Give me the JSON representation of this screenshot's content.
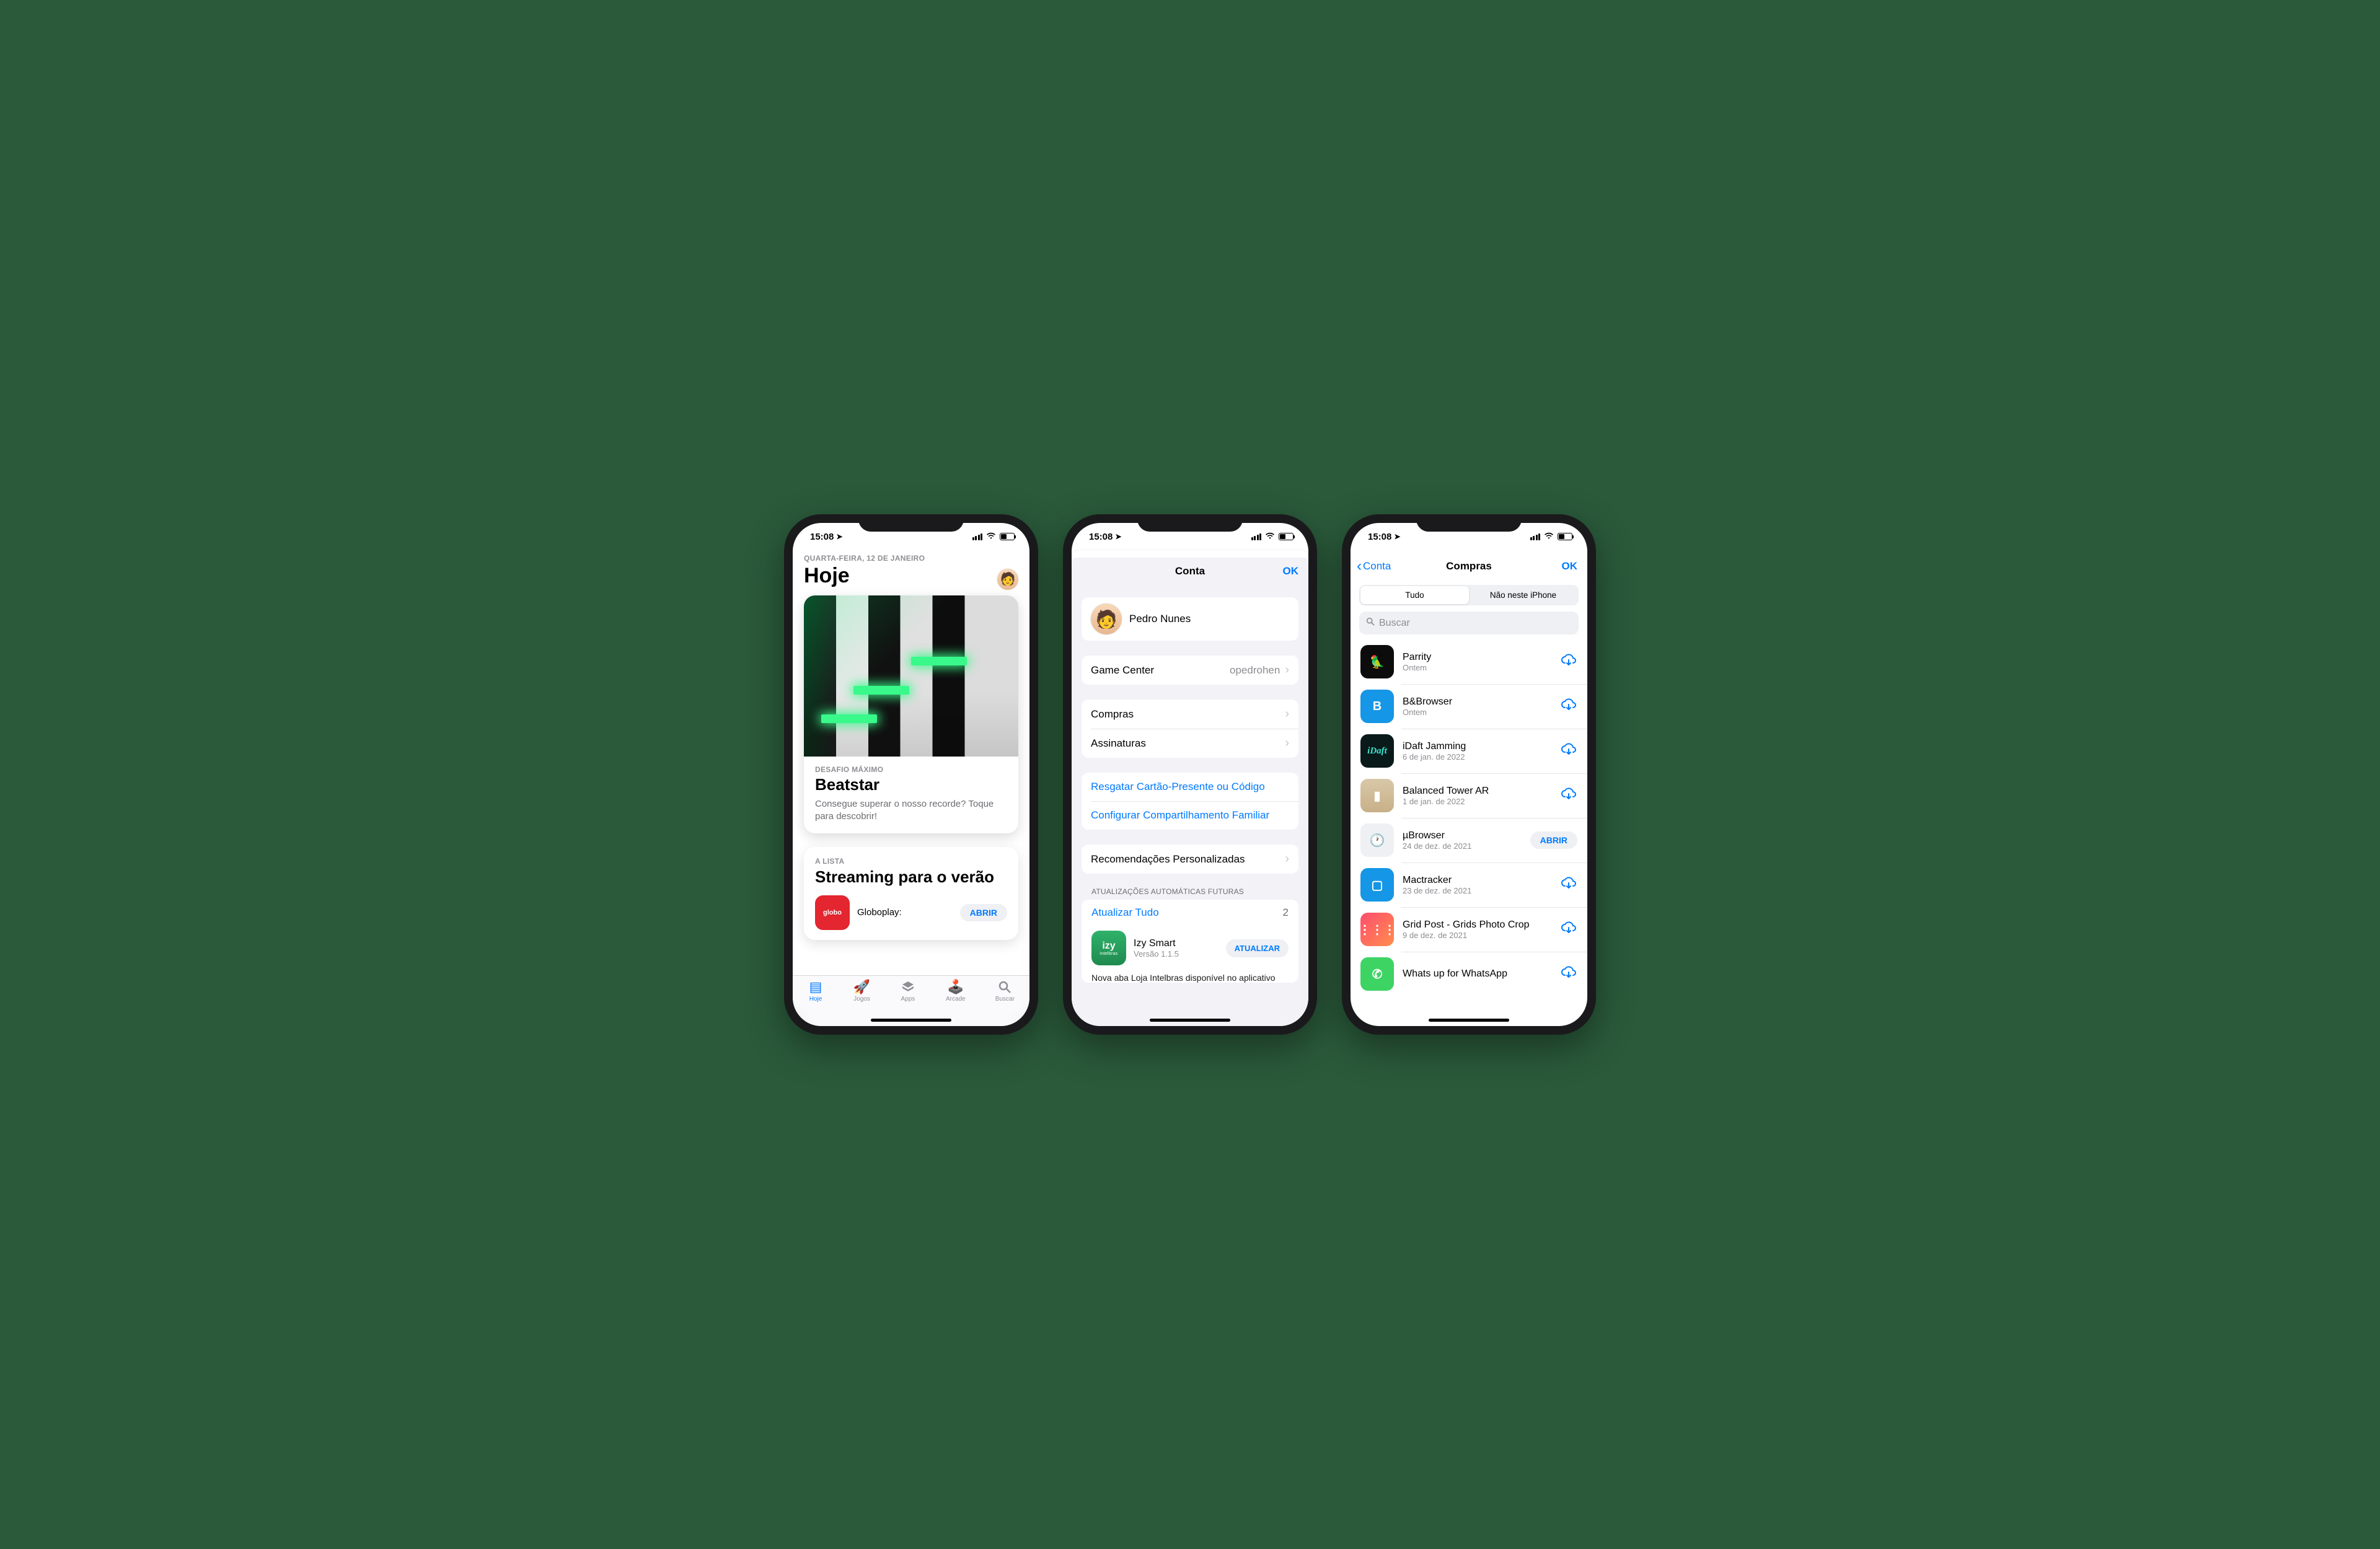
{
  "status": {
    "time": "15:08"
  },
  "phone1": {
    "date": "QUARTA-FEIRA, 12 DE JANEIRO",
    "title": "Hoje",
    "card1": {
      "eyebrow": "DESAFIO MÁXIMO",
      "title": "Beatstar",
      "sub": "Consegue superar o nosso recorde? Toque para descobrir!"
    },
    "card2": {
      "eyebrow": "A LISTA",
      "title": "Streaming para o verão",
      "app_icon_text": "globo",
      "app_name": "Globoplay:",
      "app_btn": "ABRIR"
    },
    "tabs": [
      "Hoje",
      "Jogos",
      "Apps",
      "Arcade",
      "Buscar"
    ]
  },
  "phone2": {
    "nav_title": "Conta",
    "ok": "OK",
    "profile_name": "Pedro Nunes",
    "gamecenter_label": "Game Center",
    "gamecenter_value": "opedrohen",
    "compras": "Compras",
    "assinaturas": "Assinaturas",
    "resgatar": "Resgatar Cartão-Presente ou Código",
    "compart": "Configurar Compartilhamento Familiar",
    "recom": "Recomendações Personalizadas",
    "updates_header": "ATUALIZAÇÕES AUTOMÁTICAS FUTURAS",
    "update_all": "Atualizar Tudo",
    "update_count": "2",
    "upd_app": "Izy Smart",
    "upd_ver": "Versão 1.1.5",
    "upd_btn": "ATUALIZAR",
    "upd_icon_top": "izy",
    "upd_icon_bottom": "intelbras",
    "upd_note": "Nova aba Loja Intelbras disponível no aplicativo"
  },
  "phone3": {
    "back": "Conta",
    "title": "Compras",
    "ok": "OK",
    "seg": [
      "Tudo",
      "Não neste iPhone"
    ],
    "search_placeholder": "Buscar",
    "open_btn": "ABRIR",
    "apps": [
      {
        "name": "Parrity",
        "date": "Ontem",
        "action": "cloud",
        "icon": "ic-parrity",
        "glyph": "🦜"
      },
      {
        "name": "B&Browser",
        "date": "Ontem",
        "action": "cloud",
        "icon": "ic-bb",
        "glyph": "B"
      },
      {
        "name": "iDaft Jamming",
        "date": "6 de jan. de 2022",
        "action": "cloud",
        "icon": "ic-idaft",
        "glyph": "iDaft"
      },
      {
        "name": "Balanced Tower AR",
        "date": "1 de jan. de 2022",
        "action": "cloud",
        "icon": "ic-tower",
        "glyph": "▮"
      },
      {
        "name": "µBrowser",
        "date": "24 de dez. de 2021",
        "action": "open",
        "icon": "ic-ubrow",
        "glyph": "🕐"
      },
      {
        "name": "Mactracker",
        "date": "23 de dez. de 2021",
        "action": "cloud",
        "icon": "ic-mact",
        "glyph": "▢"
      },
      {
        "name": "Grid Post - Grids Photo Crop",
        "date": "9 de dez. de 2021",
        "action": "cloud",
        "icon": "ic-grid",
        "glyph": "⋮⋮⋮"
      },
      {
        "name": "Whats up for WhatsApp",
        "date": "",
        "action": "cloud",
        "icon": "ic-whats",
        "glyph": "✆"
      }
    ]
  }
}
